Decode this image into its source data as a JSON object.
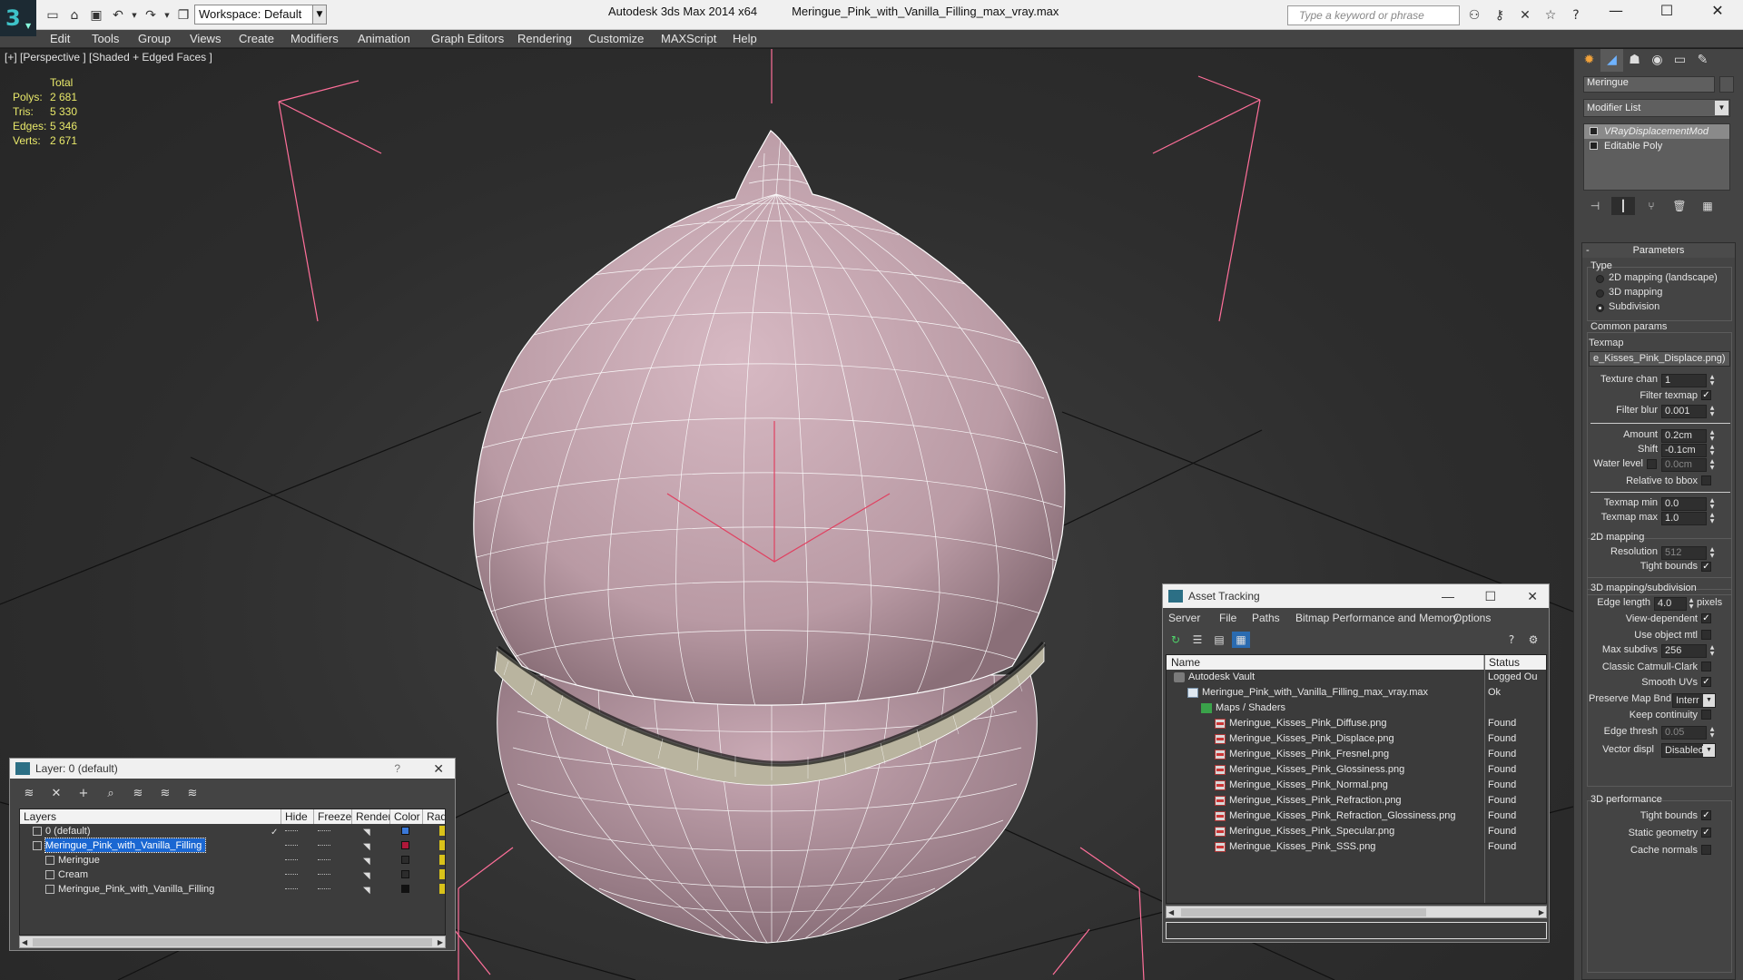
{
  "app": {
    "name": "Autodesk 3ds Max  2014 x64",
    "file": "Meringue_Pink_with_Vanilla_Filling_max_vray.max",
    "logo_letter": "3"
  },
  "toolbar": {
    "workspace": "Workspace: Default",
    "search_placeholder": "Type a keyword or phrase"
  },
  "menu": [
    "Edit",
    "Tools",
    "Group",
    "Views",
    "Create",
    "Modifiers",
    "Animation",
    "Graph Editors",
    "Rendering",
    "Customize",
    "MAXScript",
    "Help"
  ],
  "viewport": {
    "label": "[+] [Perspective ] [Shaded + Edged Faces ]",
    "stats_header": "Total",
    "stats": [
      {
        "label": "Polys:",
        "value": "2 681"
      },
      {
        "label": "Tris:",
        "value": "5 330"
      },
      {
        "label": "Edges:",
        "value": "5 346"
      },
      {
        "label": "Verts:",
        "value": "2 671"
      }
    ],
    "colors": {
      "mesh_fill": "#c8a7b2",
      "wire": "#ffffff",
      "cream": "#b8b39e",
      "bbox": "#ff6f9a"
    }
  },
  "command_panel": {
    "object_name": "Meringue",
    "modifier_list": "Modifier List",
    "stack": [
      "VRayDisplacementMod",
      "Editable Poly"
    ],
    "parameters": {
      "title": "Parameters",
      "type_label": "Type",
      "type_options": [
        "2D mapping (landscape)",
        "3D mapping",
        "Subdivision"
      ],
      "common_label": "Common params",
      "texmap_label": "Texmap",
      "texmap_value": "e_Kisses_Pink_Displace.png)",
      "texture_chan_label": "Texture chan",
      "texture_chan_value": "1",
      "filter_texmap_label": "Filter texmap",
      "filter_blur_label": "Filter blur",
      "filter_blur_value": "0.001",
      "amount_label": "Amount",
      "amount_value": "0.2cm",
      "shift_label": "Shift",
      "shift_value": "-0.1cm",
      "water_label": "Water level",
      "water_value": "0.0cm",
      "relative_label": "Relative to bbox",
      "texmap_min_label": "Texmap min",
      "texmap_min_value": "0.0",
      "texmap_max_label": "Texmap max",
      "texmap_max_value": "1.0",
      "map2d_label": "2D mapping",
      "resolution_label": "Resolution",
      "resolution_value": "512",
      "tight_bounds_label": "Tight bounds",
      "subdiv_label": "3D mapping/subdivision",
      "edge_length_label": "Edge length",
      "edge_length_value": "4.0",
      "pixels_label": "pixels",
      "view_dependent_label": "View-dependent",
      "use_object_mtl_label": "Use object mtl",
      "max_subdivs_label": "Max subdivs",
      "max_subdivs_value": "256",
      "catmull_label": "Classic Catmull-Clark",
      "smooth_uvs_label": "Smooth UVs",
      "preserve_label": "Preserve Map Bnd",
      "preserve_value": "Interr",
      "keep_continuity_label": "Keep continuity",
      "edge_thresh_label": "Edge thresh",
      "edge_thresh_value": "0.05",
      "vector_label": "Vector displ",
      "vector_value": "Disabled",
      "perf_label": "3D performance",
      "tight_bounds2_label": "Tight bounds",
      "static_geometry_label": "Static geometry",
      "cache_normals_label": "Cache normals"
    }
  },
  "layers_window": {
    "title": "Layer: 0 (default)",
    "help": "?",
    "columns": [
      "Layers",
      "Hide",
      "Freeze",
      "Render",
      "Color",
      "Radi"
    ],
    "rows": [
      {
        "name": "0 (default)",
        "color": "#3a78d8",
        "indent": 1,
        "check": "✓"
      },
      {
        "name": "Meringue_Pink_with_Vanilla_Filling",
        "color": "#b0183a",
        "indent": 1,
        "selected": true
      },
      {
        "name": "Meringue",
        "color": "#2c2c2c",
        "indent": 2
      },
      {
        "name": "Cream",
        "color": "#2c2c2c",
        "indent": 2
      },
      {
        "name": "Meringue_Pink_with_Vanilla_Filling",
        "color": "#111111",
        "indent": 2
      }
    ]
  },
  "asset_window": {
    "title": "Asset Tracking",
    "menu": [
      "Server",
      "File",
      "Paths",
      "Bitmap Performance and Memory",
      "Options"
    ],
    "columns": [
      "Name",
      "Status"
    ],
    "rows": [
      {
        "name": "Autodesk Vault",
        "status": "Logged Ou",
        "indent": 0,
        "icon": "vault"
      },
      {
        "name": "Meringue_Pink_with_Vanilla_Filling_max_vray.max",
        "status": "Ok",
        "indent": 1,
        "icon": "max"
      },
      {
        "name": "Maps / Shaders",
        "status": "",
        "indent": 2,
        "icon": "maps"
      },
      {
        "name": "Meringue_Kisses_Pink_Diffuse.png",
        "status": "Found",
        "indent": 3,
        "icon": "png"
      },
      {
        "name": "Meringue_Kisses_Pink_Displace.png",
        "status": "Found",
        "indent": 3,
        "icon": "png"
      },
      {
        "name": "Meringue_Kisses_Pink_Fresnel.png",
        "status": "Found",
        "indent": 3,
        "icon": "png"
      },
      {
        "name": "Meringue_Kisses_Pink_Glossiness.png",
        "status": "Found",
        "indent": 3,
        "icon": "png"
      },
      {
        "name": "Meringue_Kisses_Pink_Normal.png",
        "status": "Found",
        "indent": 3,
        "icon": "png"
      },
      {
        "name": "Meringue_Kisses_Pink_Refraction.png",
        "status": "Found",
        "indent": 3,
        "icon": "png"
      },
      {
        "name": "Meringue_Kisses_Pink_Refraction_Glossiness.png",
        "status": "Found",
        "indent": 3,
        "icon": "png"
      },
      {
        "name": "Meringue_Kisses_Pink_Specular.png",
        "status": "Found",
        "indent": 3,
        "icon": "png"
      },
      {
        "name": "Meringue_Kisses_Pink_SSS.png",
        "status": "Found",
        "indent": 3,
        "icon": "png"
      }
    ]
  }
}
